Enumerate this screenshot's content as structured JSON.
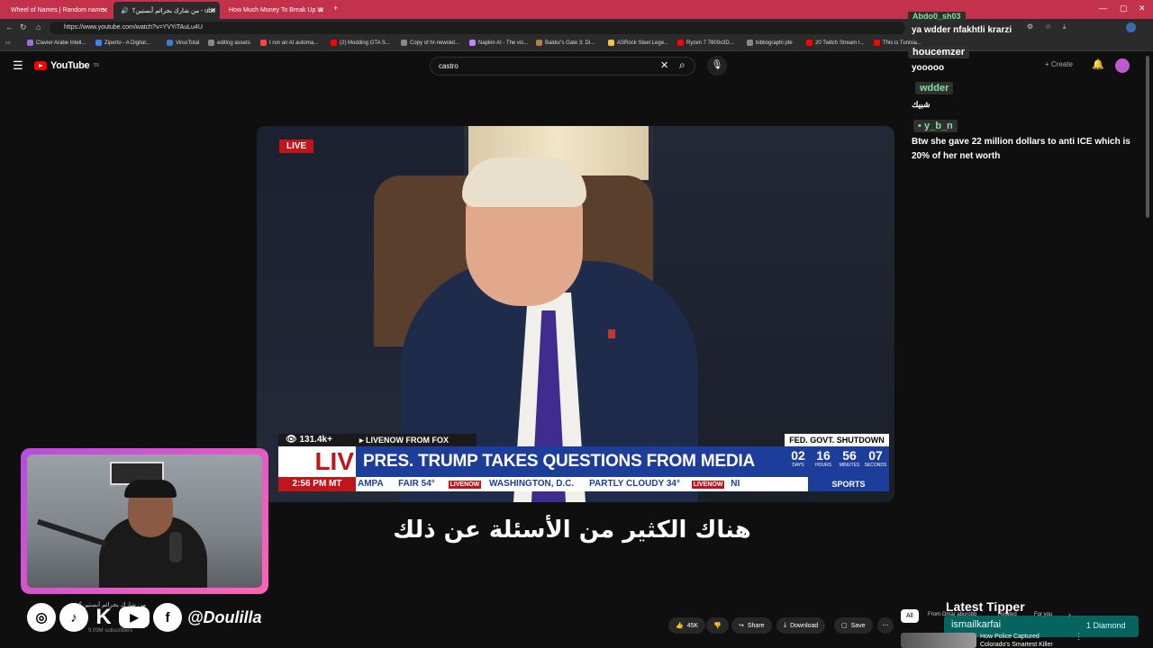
{
  "browser": {
    "tabs": [
      {
        "label": "Wheel of Names | Random name",
        "active": false
      },
      {
        "label": "من شارك بجرائم أبستين؟ - ube",
        "active": true
      },
      {
        "label": "How Much Money To Break Up W",
        "active": false
      }
    ],
    "new_tab": "+",
    "url": "https://www.youtube.com/watch?v=YVYiTAuLu4U",
    "bookmarks": [
      {
        "label": "Clavier Arabe Intell...",
        "color": "#a46bd6"
      },
      {
        "label": "Ziperto - A Digital...",
        "color": "#3b82f6"
      },
      {
        "label": "VirusTotal",
        "color": "#3a7bd5"
      },
      {
        "label": "editing assets",
        "color": "#888888"
      },
      {
        "label": "I run an AI automa...",
        "color": "#ff4444"
      },
      {
        "label": "(2) Modding GTA S...",
        "color": "#ff0000"
      },
      {
        "label": "Copy of hr-newslet...",
        "color": "#888888"
      },
      {
        "label": "Napkin AI - The vis...",
        "color": "#c084fc"
      },
      {
        "label": "Baldur's Gate 3: Di...",
        "color": "#b08040"
      },
      {
        "label": "ASRock Steel Lege...",
        "color": "#f5c542"
      },
      {
        "label": "Ryzen 7 7800x3D...",
        "color": "#ff0000"
      },
      {
        "label": "bibliographi pfe",
        "color": "#888888"
      },
      {
        "label": "20 Twitch Stream I...",
        "color": "#ff0000"
      },
      {
        "label": "This is Tunisia...",
        "color": "#ff0000"
      }
    ]
  },
  "youtube": {
    "logo": "YouTube",
    "logo_sup": "TN",
    "search_value": "castro",
    "create_label": "Create"
  },
  "video": {
    "live_badge": "LIVE",
    "viewers": "131.4k+",
    "source": "LIVENOW FROM FOX",
    "headline": "PRES. TRUMP TAKES QUESTIONS FROM MEDIA",
    "brand_partial": "LIV",
    "shutdown_label": "FED. GOVT. SHUTDOWN",
    "countdown": [
      {
        "value": "02",
        "unit": "DAYS"
      },
      {
        "value": "16",
        "unit": "HOURS"
      },
      {
        "value": "56",
        "unit": "MINUTES"
      },
      {
        "value": "07",
        "unit": "SECONDS"
      }
    ],
    "time": "2:56 PM MT",
    "ticker": [
      "AMPA",
      "FAIR 54°",
      "WASHINGTON, D.C.",
      "PARTLY CLOUDY 34°",
      "NI"
    ],
    "ticker_brand": "LIVENOW",
    "sports": "SPORTS",
    "subtitle": "هناك الكثير من الأسئلة عن ذلك"
  },
  "chat": [
    {
      "name": "Abdo0_sh03",
      "message": "ya wdder nfakhtli krarzi"
    },
    {
      "name": "houcemzer",
      "message": "yooooo"
    },
    {
      "name": "wdder",
      "message": "شبيك"
    },
    {
      "name": "y_b_n",
      "message": "Btw she gave 22 million dollars to anti ICE which is 20% of her net worth"
    }
  ],
  "stream_overlay": {
    "handle": "@Doulilla",
    "latest_tipper_label": "Latest Tipper",
    "tipper_name": "ismailkarfai",
    "tipper_amount": "1 Diamond"
  },
  "actions": {
    "likes": "45K",
    "share": "Share",
    "download": "Download",
    "save": "Save"
  },
  "filters": [
    "All",
    "From Omar aburobb",
    "Related",
    "For you"
  ],
  "recommendation": {
    "title": "How Police Captured Colorado's Smartest Killer"
  },
  "channel": {
    "title_partial": "من شارك بجرائم أبستين؟",
    "subscribers": "9.09M subscribers"
  },
  "colors": {
    "tabbar": "#c4314b",
    "yt_red": "#ff0000",
    "chat_name": "#7fe39b",
    "fox_blue": "#1c3e9a",
    "fox_red": "#c1141b"
  }
}
